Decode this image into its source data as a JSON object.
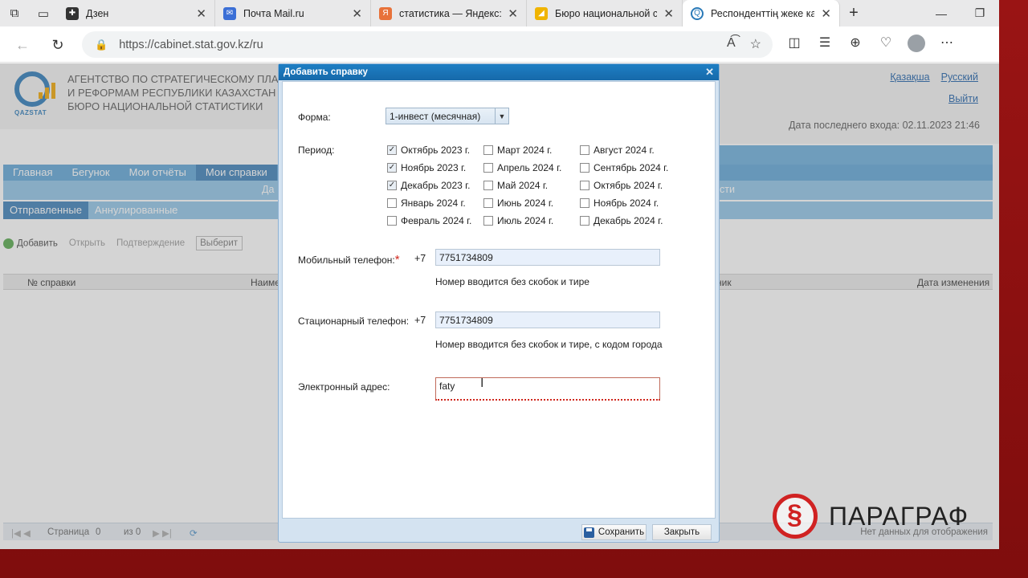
{
  "browser": {
    "tabs": [
      {
        "title": "Дзен",
        "fav_color": "#333333",
        "fav_glyph": "✚"
      },
      {
        "title": "Почта Mail.ru",
        "fav_color": "#3b6fd6",
        "fav_glyph": "✉"
      },
      {
        "title": "статистика — Яндекс: на",
        "fav_color": "#e8723a",
        "fav_glyph": "Я"
      },
      {
        "title": "Бюро национальной ст",
        "fav_color": "#f0b400",
        "fav_glyph": "◢"
      },
      {
        "title": "Респонденттің жеке каб",
        "fav_color": "#ffffff",
        "fav_glyph": "Q"
      }
    ],
    "url": "https://cabinet.stat.gov.kz/ru"
  },
  "site": {
    "logo_text": "QAZSTAT",
    "agency_lines": [
      "АГЕНТСТВО ПО СТРАТЕГИЧЕСКОМУ ПЛАНИ",
      "И РЕФОРМАМ РЕСПУБЛИКИ КАЗАХСТАН",
      "БЮРО НАЦИОНАЛЬНОЙ СТАТИСТИКИ"
    ],
    "lang_kz": "Қазақша",
    "lang_ru": "Русский",
    "logout": "Выйти",
    "last_login": "Дата последнего входа: 02.11.2023 21:46",
    "nav": [
      "Главная",
      "Бегунок",
      "Мои отчёты",
      "Мои справки"
    ],
    "subbar_left": "Да",
    "subbar_right": "сти",
    "tabs": [
      "Отправленные",
      "Аннулированные"
    ],
    "toolbar": {
      "add": "Добавить",
      "open": "Открыть",
      "confirm": "Подтверждение",
      "select": "Выберит"
    },
    "grid_headers": {
      "num": "№ справки",
      "name": "Наиме",
      "col3": "ник",
      "changed": "Дата изменения"
    },
    "pager": {
      "page": "Страница",
      "page_val": "0",
      "of": "из 0",
      "empty": "Нет данных для отображения"
    }
  },
  "dialog": {
    "title": "Добавить справку",
    "form_label": "Форма:",
    "form_value": "1-инвест (месячная)",
    "period_label": "Период:",
    "periods": [
      {
        "label": "Октябрь 2023 г.",
        "checked": true
      },
      {
        "label": "Ноябрь 2023 г.",
        "checked": true
      },
      {
        "label": "Декабрь 2023 г.",
        "checked": true
      },
      {
        "label": "Январь 2024 г.",
        "checked": false
      },
      {
        "label": "Февраль 2024 г.",
        "checked": false
      },
      {
        "label": "Март 2024 г.",
        "checked": false
      },
      {
        "label": "Апрель 2024 г.",
        "checked": false
      },
      {
        "label": "Май 2024 г.",
        "checked": false
      },
      {
        "label": "Июнь 2024 г.",
        "checked": false
      },
      {
        "label": "Июль 2024 г.",
        "checked": false
      },
      {
        "label": "Август 2024 г.",
        "checked": false
      },
      {
        "label": "Сентябрь 2024 г.",
        "checked": false
      },
      {
        "label": "Октябрь 2024 г.",
        "checked": false
      },
      {
        "label": "Ноябрь 2024 г.",
        "checked": false
      },
      {
        "label": "Декабрь 2024 г.",
        "checked": false
      }
    ],
    "mobile_label": "Мобильный телефон:",
    "mobile_prefix": "+7",
    "mobile_value": "7751734809",
    "mobile_hint": "Номер вводится без скобок и тире",
    "phone_label": "Стационарный телефон:",
    "phone_prefix": "+7",
    "phone_value": "7751734809",
    "phone_hint": "Номер вводится без скобок и тире, с кодом города",
    "email_label": "Электронный адрес:",
    "email_value": "faty",
    "save": "Сохранить",
    "close": "Закрыть"
  },
  "watermark": "ПАРАГРАФ"
}
